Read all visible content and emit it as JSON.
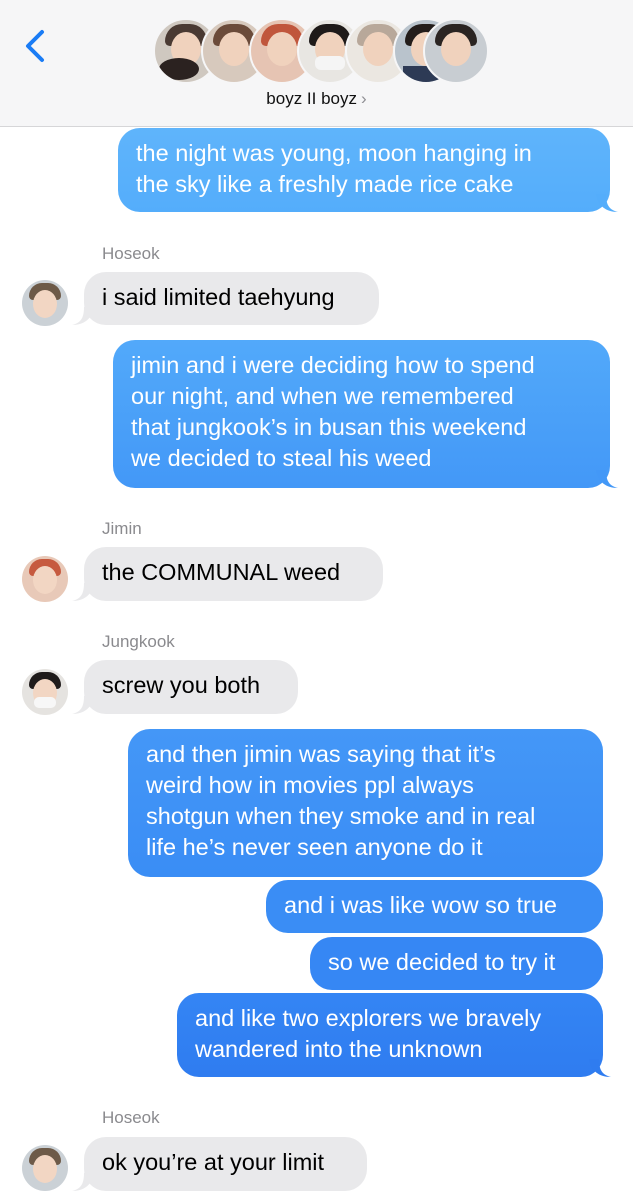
{
  "header": {
    "group_name": "boyz II boyz",
    "chevron": "›",
    "back_icon": "chevron-left-icon",
    "accent_color": "#1a7cf5"
  },
  "messages": [
    {
      "type": "outgoing",
      "lines": [
        "the night was young, moon hanging in",
        "the sky like a freshly made rice cake"
      ]
    },
    {
      "type": "incoming",
      "sender": "Hoseok",
      "lines": [
        "i said limited taehyung"
      ]
    },
    {
      "type": "outgoing",
      "lines": [
        "jimin and i were deciding how to spend",
        "our night, and when we remembered",
        "that jungkook’s in busan this weekend",
        "we decided to steal his weed"
      ]
    },
    {
      "type": "incoming",
      "sender": "Jimin",
      "lines": [
        "the COMMUNAL weed"
      ]
    },
    {
      "type": "incoming",
      "sender": "Jungkook",
      "lines": [
        "screw you both"
      ]
    },
    {
      "type": "outgoing",
      "lines": [
        "and then jimin was saying that it’s",
        "weird how in movies ppl always",
        "shotgun when they smoke and in real",
        "life he’s never seen anyone do it"
      ]
    },
    {
      "type": "outgoing",
      "lines": [
        "and i was like wow so true"
      ]
    },
    {
      "type": "outgoing",
      "lines": [
        "so we decided to try it"
      ]
    },
    {
      "type": "outgoing",
      "lines": [
        "and like two explorers we bravely",
        "wandered into the unknown"
      ]
    },
    {
      "type": "incoming",
      "sender": "Hoseok",
      "lines": [
        "ok you’re at your limit"
      ]
    }
  ],
  "colors": {
    "outgoing_top": "#5eb3fb",
    "outgoing_bottom": "#2f7cf0",
    "incoming": "#e9e9eb"
  }
}
